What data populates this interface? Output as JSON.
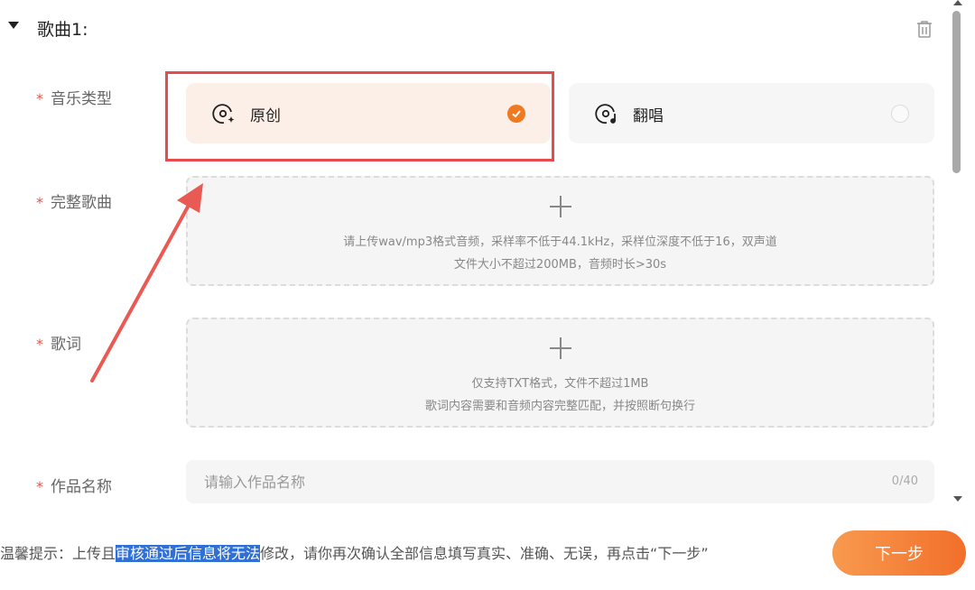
{
  "section": {
    "title": "歌曲1:"
  },
  "fields": {
    "music_type": {
      "required_mark": "*",
      "label": "音乐类型",
      "options": [
        {
          "label": "原创",
          "selected": true
        },
        {
          "label": "翻唱",
          "selected": false
        }
      ]
    },
    "full_song": {
      "required_mark": "*",
      "label": "完整歌曲",
      "hint_line1": "请上传wav/mp3格式音频，采样率不低于44.1kHz，采样位深度不低于16，双声道",
      "hint_line2": "文件大小不超过200MB，音频时长>30s"
    },
    "lyrics": {
      "required_mark": "*",
      "label": "歌词",
      "hint_line1": "仅支持TXT格式，文件不超过1MB",
      "hint_line2": "歌词内容需要和音频内容完整匹配，并按照断句换行"
    },
    "work_name": {
      "required_mark": "*",
      "label": "作品名称",
      "placeholder": "请输入作品名称",
      "value": "",
      "counter": "0/40"
    }
  },
  "footer": {
    "tip_prefix": "温馨提示：上传且",
    "tip_selected": "审核通过后信息将无法",
    "tip_suffix": "修改，请你再次确认全部信息填写真实、准确、无误，再点击“下一步”",
    "next_label": "下一步"
  },
  "colors": {
    "accent": "#f07a22",
    "annotation_red": "#e84b4b",
    "selection_blue": "#2f6fd6"
  }
}
